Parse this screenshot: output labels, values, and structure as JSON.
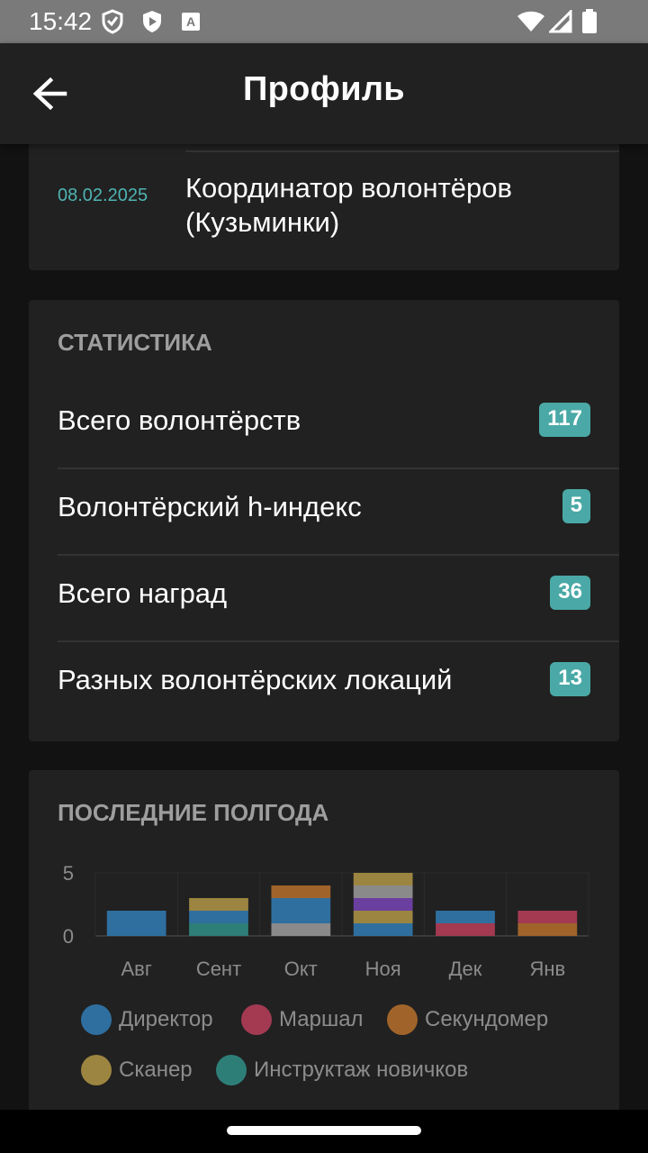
{
  "status_bar": {
    "time": "15:42"
  },
  "app_bar": {
    "title": "Профиль"
  },
  "role": {
    "date": "08.02.2025",
    "name_line1": "Координатор волонтёров",
    "name_line2": "(Кузьминки)"
  },
  "statistics": {
    "title": "СТАТИСТИКА",
    "rows": [
      {
        "label": "Всего волонтёрств",
        "value": "117"
      },
      {
        "label": "Волонтёрский h-индекс",
        "value": "5"
      },
      {
        "label": "Всего наград",
        "value": "36"
      },
      {
        "label": "Разных волонтёрских локаций",
        "value": "13"
      }
    ]
  },
  "half_year": {
    "title": "ПОСЛЕДНИЕ ПОЛГОДА",
    "legend": [
      {
        "name": "Директор",
        "color": "#2f6f9f"
      },
      {
        "name": "Маршал",
        "color": "#a33a52"
      },
      {
        "name": "Секундомер",
        "color": "#a0642a"
      },
      {
        "name": "Сканер",
        "color": "#9c8540"
      },
      {
        "name": "Инструктаж новичков",
        "color": "#2e7e78"
      }
    ]
  },
  "chart_data": {
    "type": "bar",
    "stacked": true,
    "categories": [
      "Авг",
      "Сент",
      "Окт",
      "Ноя",
      "Дек",
      "Янв"
    ],
    "y_ticks": [
      "5",
      "0"
    ],
    "ylim": [
      0,
      5
    ],
    "segments": [
      [
        {
          "role": "Директор",
          "value": 2,
          "color": "#2f6f9f"
        }
      ],
      [
        {
          "role": "Инструктаж новичков",
          "value": 1,
          "color": "#2e7e78"
        },
        {
          "role": "Директор",
          "value": 1,
          "color": "#2f6f9f"
        },
        {
          "role": "Сканер",
          "value": 1,
          "color": "#9c8540"
        }
      ],
      [
        {
          "role": "other",
          "value": 1,
          "color": "#8a8a8a"
        },
        {
          "role": "Директор",
          "value": 2,
          "color": "#2f6f9f"
        },
        {
          "role": "Секундомер",
          "value": 1,
          "color": "#a0642a"
        }
      ],
      [
        {
          "role": "Директор",
          "value": 1,
          "color": "#2f6f9f"
        },
        {
          "role": "Сканер",
          "value": 1,
          "color": "#9c8540"
        },
        {
          "role": "other",
          "value": 1,
          "color": "#6a3fa0"
        },
        {
          "role": "other",
          "value": 1,
          "color": "#8a8a8a"
        },
        {
          "role": "Сканер",
          "value": 1,
          "color": "#9c8540"
        }
      ],
      [
        {
          "role": "Маршал",
          "value": 1,
          "color": "#a33a52"
        },
        {
          "role": "Директор",
          "value": 1,
          "color": "#2f6f9f"
        }
      ],
      [
        {
          "role": "Секундомер",
          "value": 1,
          "color": "#a0642a"
        },
        {
          "role": "Маршал",
          "value": 1,
          "color": "#a33a52"
        }
      ]
    ],
    "grid": true,
    "legend_position": "bottom"
  }
}
